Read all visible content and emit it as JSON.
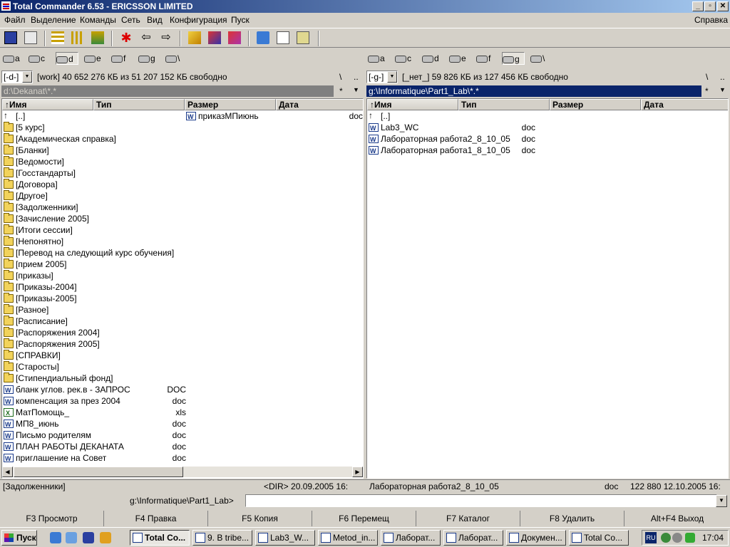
{
  "window": {
    "title": "Total Commander 6.53 - ERICSSON LIMITED",
    "min": "_",
    "max": "▫",
    "close": "✕"
  },
  "menu": [
    "Файл",
    "Выделение",
    "Команды",
    "Сеть",
    "Вид",
    "Конфигурация",
    "Пуск"
  ],
  "menu_help": "Справка",
  "drives": [
    "a",
    "c",
    "d",
    "e",
    "f",
    "g",
    "\\"
  ],
  "left": {
    "drive_combo": "[-d-]",
    "free": "[work]  40 652 276 КБ из 51 207 152 КБ свободно",
    "root_btn": "\\",
    "up_btn": "..",
    "path": "d:\\Dekanat\\*.*",
    "star": "*",
    "hist": "▼",
    "headers": [
      "↑Имя",
      "Тип",
      "Размер",
      "Дата"
    ],
    "files_col1": [
      {
        "name": "[..]",
        "ext": "",
        "icon": "up"
      },
      {
        "name": "[5 курс]",
        "ext": "",
        "icon": "folder"
      },
      {
        "name": "[Академическая справка]",
        "ext": "",
        "icon": "folder"
      },
      {
        "name": "[Бланки]",
        "ext": "",
        "icon": "folder"
      },
      {
        "name": "[Ведомости]",
        "ext": "",
        "icon": "folder"
      },
      {
        "name": "[Госстандарты]",
        "ext": "",
        "icon": "folder"
      },
      {
        "name": "[Договора]",
        "ext": "",
        "icon": "folder"
      },
      {
        "name": "[Другое]",
        "ext": "",
        "icon": "folder"
      },
      {
        "name": "[Задолженники]",
        "ext": "",
        "icon": "folder"
      },
      {
        "name": "[Зачисление 2005]",
        "ext": "",
        "icon": "folder"
      },
      {
        "name": "[Итоги сессии]",
        "ext": "",
        "icon": "folder"
      },
      {
        "name": "[Непонятно]",
        "ext": "",
        "icon": "folder"
      },
      {
        "name": "[Перевод на следующий курс обучения]",
        "ext": "",
        "icon": "folder"
      },
      {
        "name": "[прием 2005]",
        "ext": "",
        "icon": "folder"
      },
      {
        "name": "[приказы]",
        "ext": "",
        "icon": "folder"
      },
      {
        "name": "[Приказы-2004]",
        "ext": "",
        "icon": "folder"
      },
      {
        "name": "[Приказы-2005]",
        "ext": "",
        "icon": "folder"
      },
      {
        "name": "[Разное]",
        "ext": "",
        "icon": "folder"
      },
      {
        "name": "[Расписание]",
        "ext": "",
        "icon": "folder"
      },
      {
        "name": "[Распоряжения 2004]",
        "ext": "",
        "icon": "folder"
      },
      {
        "name": "[Распоряжения 2005]",
        "ext": "",
        "icon": "folder"
      },
      {
        "name": "[СПРАВКИ]",
        "ext": "",
        "icon": "folder"
      },
      {
        "name": "[Старосты]",
        "ext": "",
        "icon": "folder"
      },
      {
        "name": "[Стипендиальный фонд]",
        "ext": "",
        "icon": "folder"
      },
      {
        "name": "бланк углов. рек.в - ЗАПРОС",
        "ext": "DOC",
        "icon": "doc"
      },
      {
        "name": "компенсация за през 2004",
        "ext": "doc",
        "icon": "doc"
      },
      {
        "name": "МатПомощь_",
        "ext": "xls",
        "icon": "xls"
      },
      {
        "name": "МП8_июнь",
        "ext": "doc",
        "icon": "doc"
      },
      {
        "name": "Письмо родителям",
        "ext": "doc",
        "icon": "doc"
      },
      {
        "name": "ПЛАН РАБОТЫ ДЕКАНАТА",
        "ext": "doc",
        "icon": "doc"
      },
      {
        "name": "приглашение на Совет",
        "ext": "doc",
        "icon": "doc"
      }
    ],
    "files_col2": [
      {
        "name": "приказМПиюнь",
        "ext": "doc",
        "icon": "doc"
      }
    ]
  },
  "right": {
    "drive_combo": "[-g-]",
    "free": "[_нет_]  59 826 КБ из 127 456 КБ свободно",
    "root_btn": "\\",
    "up_btn": "..",
    "path": "g:\\Informatique\\Part1_Lab\\*.*",
    "star": "*",
    "hist": "▼",
    "headers": [
      "↑Имя",
      "Тип",
      "Размер",
      "Дата"
    ],
    "files": [
      {
        "name": "[..]",
        "ext": "",
        "icon": "up"
      },
      {
        "name": "Lab3_WC",
        "ext": "doc",
        "icon": "doc"
      },
      {
        "name": "Лабораторная работа2_8_10_05",
        "ext": "doc",
        "icon": "doc"
      },
      {
        "name": "Лабораторная работа1_8_10_05",
        "ext": "doc",
        "icon": "doc"
      }
    ]
  },
  "status": {
    "left_name": "[Задолженники]",
    "left_info": "<DIR>   20.09.2005 16:",
    "right_name": "Лабораторная работа2_8_10_05",
    "right_ext": "doc",
    "right_info": "122 880 12.10.2005 16:"
  },
  "cmd": {
    "prompt": "g:\\Informatique\\Part1_Lab>",
    "value": ""
  },
  "fkeys": [
    "F3 Просмотр",
    "F4 Правка",
    "F5 Копия",
    "F6 Перемещ",
    "F7 Каталог",
    "F8 Удалить",
    "Alt+F4 Выход"
  ],
  "taskbar": {
    "start": "Пуск",
    "tasks": [
      "Total Co...",
      "9. В tribe...",
      "Lab3_W...",
      "Metod_in...",
      "Лаборат...",
      "Лаборат...",
      "Докумен...",
      "Total Co..."
    ],
    "lang": "RU",
    "clock": "17:04"
  },
  "colors": {
    "titlebar": "#0a246a",
    "active_path": "#0a246a",
    "inactive_path": "#808080",
    "folder": "#f2d35b"
  }
}
